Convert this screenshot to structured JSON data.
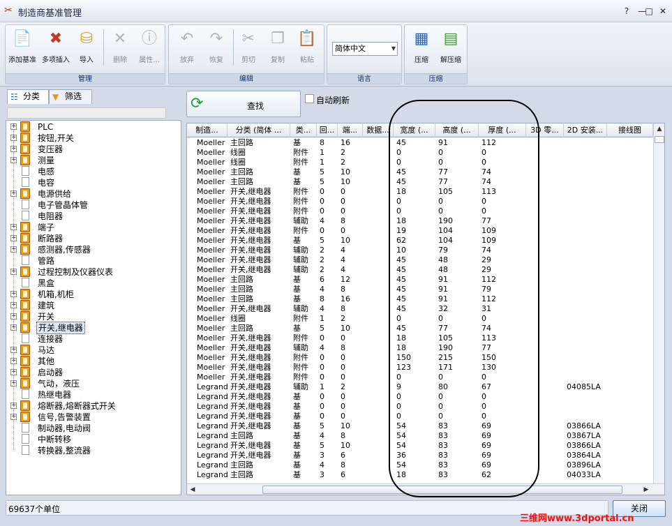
{
  "window": {
    "title": "制造商基准管理",
    "controls": [
      "?",
      "—",
      "□",
      "✕"
    ]
  },
  "ribbon": {
    "groups": [
      {
        "label": "管理",
        "buttons": [
          {
            "label": "添加基准",
            "icon": "add-datum-icon",
            "enabled": true
          },
          {
            "label": "多项插入",
            "icon": "multi-insert-icon",
            "enabled": true
          },
          {
            "label": "导入",
            "icon": "import-icon",
            "enabled": true
          },
          {
            "label": "删除",
            "icon": "delete-icon",
            "enabled": false
          },
          {
            "label": "属性...",
            "icon": "properties-icon",
            "enabled": false
          }
        ]
      },
      {
        "label": "编辑",
        "buttons": [
          {
            "label": "放弃",
            "icon": "undo-icon",
            "enabled": false
          },
          {
            "label": "恢复",
            "icon": "redo-icon",
            "enabled": false
          },
          {
            "label": "剪切",
            "icon": "cut-icon",
            "enabled": false
          },
          {
            "label": "复制",
            "icon": "copy-icon",
            "enabled": false
          },
          {
            "label": "粘贴",
            "icon": "paste-icon",
            "enabled": false
          }
        ]
      },
      {
        "label": "语言",
        "select_value": "简体中文"
      },
      {
        "label": "压缩",
        "buttons": [
          {
            "label": "压缩",
            "icon": "compress-icon",
            "enabled": true
          },
          {
            "label": "解压缩",
            "icon": "decompress-icon",
            "enabled": true
          }
        ]
      }
    ]
  },
  "left_panel": {
    "tabs": [
      {
        "label": "分类",
        "icon": "tree-icon",
        "active": true
      },
      {
        "label": "筛选",
        "icon": "filter-icon",
        "active": false
      }
    ],
    "tree": [
      {
        "label": "PLC",
        "expandable": true,
        "type": "book"
      },
      {
        "label": "按钮,开关",
        "expandable": true,
        "type": "book"
      },
      {
        "label": "变压器",
        "expandable": true,
        "type": "book"
      },
      {
        "label": "测量",
        "expandable": true,
        "type": "book"
      },
      {
        "label": "电感",
        "expandable": false,
        "type": "doc"
      },
      {
        "label": "电容",
        "expandable": false,
        "type": "doc"
      },
      {
        "label": "电源供给",
        "expandable": true,
        "type": "book"
      },
      {
        "label": "电子管晶体管",
        "expandable": false,
        "type": "doc"
      },
      {
        "label": "电阻器",
        "expandable": false,
        "type": "doc"
      },
      {
        "label": "端子",
        "expandable": true,
        "type": "book"
      },
      {
        "label": "断路器",
        "expandable": true,
        "type": "book"
      },
      {
        "label": "感测器,传感器",
        "expandable": true,
        "type": "book"
      },
      {
        "label": "管路",
        "expandable": false,
        "type": "doc"
      },
      {
        "label": "过程控制及仪器仪表",
        "expandable": true,
        "type": "book"
      },
      {
        "label": "黑盒",
        "expandable": false,
        "type": "doc"
      },
      {
        "label": "机箱,机柜",
        "expandable": true,
        "type": "book"
      },
      {
        "label": "建筑",
        "expandable": true,
        "type": "book"
      },
      {
        "label": "开关",
        "expandable": true,
        "type": "book"
      },
      {
        "label": "开关,继电器",
        "expandable": true,
        "type": "book",
        "selected": true
      },
      {
        "label": "连接器",
        "expandable": false,
        "type": "doc"
      },
      {
        "label": "马达",
        "expandable": true,
        "type": "book"
      },
      {
        "label": "其他",
        "expandable": true,
        "type": "book"
      },
      {
        "label": "启动器",
        "expandable": true,
        "type": "book"
      },
      {
        "label": "气动，液压",
        "expandable": true,
        "type": "book"
      },
      {
        "label": "热继电器",
        "expandable": false,
        "type": "doc"
      },
      {
        "label": "熔断器,熔断器式开关",
        "expandable": true,
        "type": "book"
      },
      {
        "label": "信号,告警装置",
        "expandable": true,
        "type": "book"
      },
      {
        "label": "制动器,电动阀",
        "expandable": false,
        "type": "doc"
      },
      {
        "label": "中断转移",
        "expandable": false,
        "type": "doc"
      },
      {
        "label": "转换器,整流器",
        "expandable": false,
        "type": "doc"
      }
    ]
  },
  "toolbar": {
    "find_label": "查找",
    "auto_refresh_label": "自动刷新",
    "auto_refresh_checked": false
  },
  "grid": {
    "columns": [
      "制造...",
      "分类 (简体 ...",
      "类...",
      "回...",
      "端...",
      "数据...",
      "宽度 (...",
      "高度 (...",
      "厚度 (...",
      "3D 零...",
      "2D 安装...",
      "接线图"
    ],
    "rows": [
      [
        "Moeller",
        "主回路",
        "基",
        "8",
        "16",
        "",
        "45",
        "91",
        "112",
        "",
        ""
      ],
      [
        "Moeller",
        "线圈",
        "附件",
        "1",
        "2",
        "",
        "0",
        "0",
        "0",
        "",
        ""
      ],
      [
        "Moeller",
        "线圈",
        "附件",
        "1",
        "2",
        "",
        "0",
        "0",
        "0",
        "",
        ""
      ],
      [
        "Moeller",
        "主回路",
        "基",
        "5",
        "10",
        "",
        "45",
        "77",
        "74",
        "",
        ""
      ],
      [
        "Moeller",
        "主回路",
        "基",
        "5",
        "10",
        "",
        "45",
        "77",
        "74",
        "",
        ""
      ],
      [
        "Moeller",
        "开关,继电器",
        "附件",
        "0",
        "0",
        "",
        "18",
        "105",
        "113",
        "",
        ""
      ],
      [
        "Moeller",
        "开关,继电器",
        "附件",
        "0",
        "0",
        "",
        "0",
        "0",
        "0",
        "",
        ""
      ],
      [
        "Moeller",
        "开关,继电器",
        "附件",
        "0",
        "0",
        "",
        "0",
        "0",
        "0",
        "",
        ""
      ],
      [
        "Moeller",
        "开关,继电器",
        "辅助",
        "4",
        "8",
        "",
        "18",
        "190",
        "77",
        "",
        ""
      ],
      [
        "Moeller",
        "开关,继电器",
        "附件",
        "0",
        "0",
        "",
        "19",
        "104",
        "109",
        "",
        ""
      ],
      [
        "Moeller",
        "开关,继电器",
        "基",
        "5",
        "10",
        "",
        "62",
        "104",
        "109",
        "",
        ""
      ],
      [
        "Moeller",
        "开关,继电器",
        "辅助",
        "2",
        "4",
        "",
        "10",
        "79",
        "74",
        "",
        ""
      ],
      [
        "Moeller",
        "开关,继电器",
        "辅助",
        "2",
        "4",
        "",
        "45",
        "48",
        "29",
        "",
        ""
      ],
      [
        "Moeller",
        "开关,继电器",
        "辅助",
        "2",
        "4",
        "",
        "45",
        "48",
        "29",
        "",
        ""
      ],
      [
        "Moeller",
        "主回路",
        "基",
        "6",
        "12",
        "",
        "45",
        "91",
        "112",
        "",
        ""
      ],
      [
        "Moeller",
        "主回路",
        "基",
        "4",
        "8",
        "",
        "45",
        "91",
        "79",
        "",
        ""
      ],
      [
        "Moeller",
        "主回路",
        "基",
        "8",
        "16",
        "",
        "45",
        "91",
        "112",
        "",
        ""
      ],
      [
        "Moeller",
        "开关,继电器",
        "辅助",
        "4",
        "8",
        "",
        "45",
        "32",
        "31",
        "",
        ""
      ],
      [
        "Moeller",
        "线圈",
        "附件",
        "1",
        "2",
        "",
        "0",
        "0",
        "0",
        "",
        ""
      ],
      [
        "Moeller",
        "主回路",
        "基",
        "5",
        "10",
        "",
        "45",
        "77",
        "74",
        "",
        ""
      ],
      [
        "Moeller",
        "开关,继电器",
        "附件",
        "0",
        "0",
        "",
        "18",
        "105",
        "113",
        "",
        ""
      ],
      [
        "Moeller",
        "开关,继电器",
        "辅助",
        "4",
        "8",
        "",
        "18",
        "190",
        "77",
        "",
        ""
      ],
      [
        "Moeller",
        "开关,继电器",
        "附件",
        "0",
        "0",
        "",
        "150",
        "215",
        "150",
        "",
        ""
      ],
      [
        "Moeller",
        "开关,继电器",
        "附件",
        "0",
        "0",
        "",
        "123",
        "171",
        "130",
        "",
        ""
      ],
      [
        "Moeller",
        "开关,继电器",
        "附件",
        "0",
        "0",
        "",
        "0",
        "0",
        "0",
        "",
        ""
      ],
      [
        "Legrand",
        "开关,继电器",
        "辅助",
        "1",
        "2",
        "",
        "9",
        "80",
        "67",
        "",
        "04085LA"
      ],
      [
        "Legrand",
        "开关,继电器",
        "基",
        "0",
        "0",
        "",
        "0",
        "0",
        "0",
        "",
        ""
      ],
      [
        "Legrand",
        "开关,继电器",
        "基",
        "0",
        "0",
        "",
        "0",
        "0",
        "0",
        "",
        ""
      ],
      [
        "Legrand",
        "开关,继电器",
        "基",
        "0",
        "0",
        "",
        "0",
        "0",
        "0",
        "",
        ""
      ],
      [
        "Legrand",
        "开关,继电器",
        "基",
        "5",
        "10",
        "",
        "54",
        "83",
        "69",
        "",
        "03866LA"
      ],
      [
        "Legrand",
        "主回路",
        "基",
        "4",
        "8",
        "",
        "54",
        "83",
        "69",
        "",
        "03867LA"
      ],
      [
        "Legrand",
        "开关,继电器",
        "基",
        "5",
        "10",
        "",
        "54",
        "83",
        "69",
        "",
        "03866LA"
      ],
      [
        "Legrand",
        "开关,继电器",
        "基",
        "3",
        "6",
        "",
        "36",
        "83",
        "69",
        "",
        "03864LA"
      ],
      [
        "Legrand",
        "主回路",
        "基",
        "4",
        "8",
        "",
        "54",
        "83",
        "69",
        "",
        "03896LA"
      ],
      [
        "Legrand",
        "主回路",
        "基",
        "3",
        "6",
        "",
        "18",
        "83",
        "62",
        "",
        "04033LA"
      ]
    ]
  },
  "status": {
    "count_text": "69637个单位",
    "close_label": "关闭"
  },
  "watermark": "三维网www.3dportal.cn"
}
